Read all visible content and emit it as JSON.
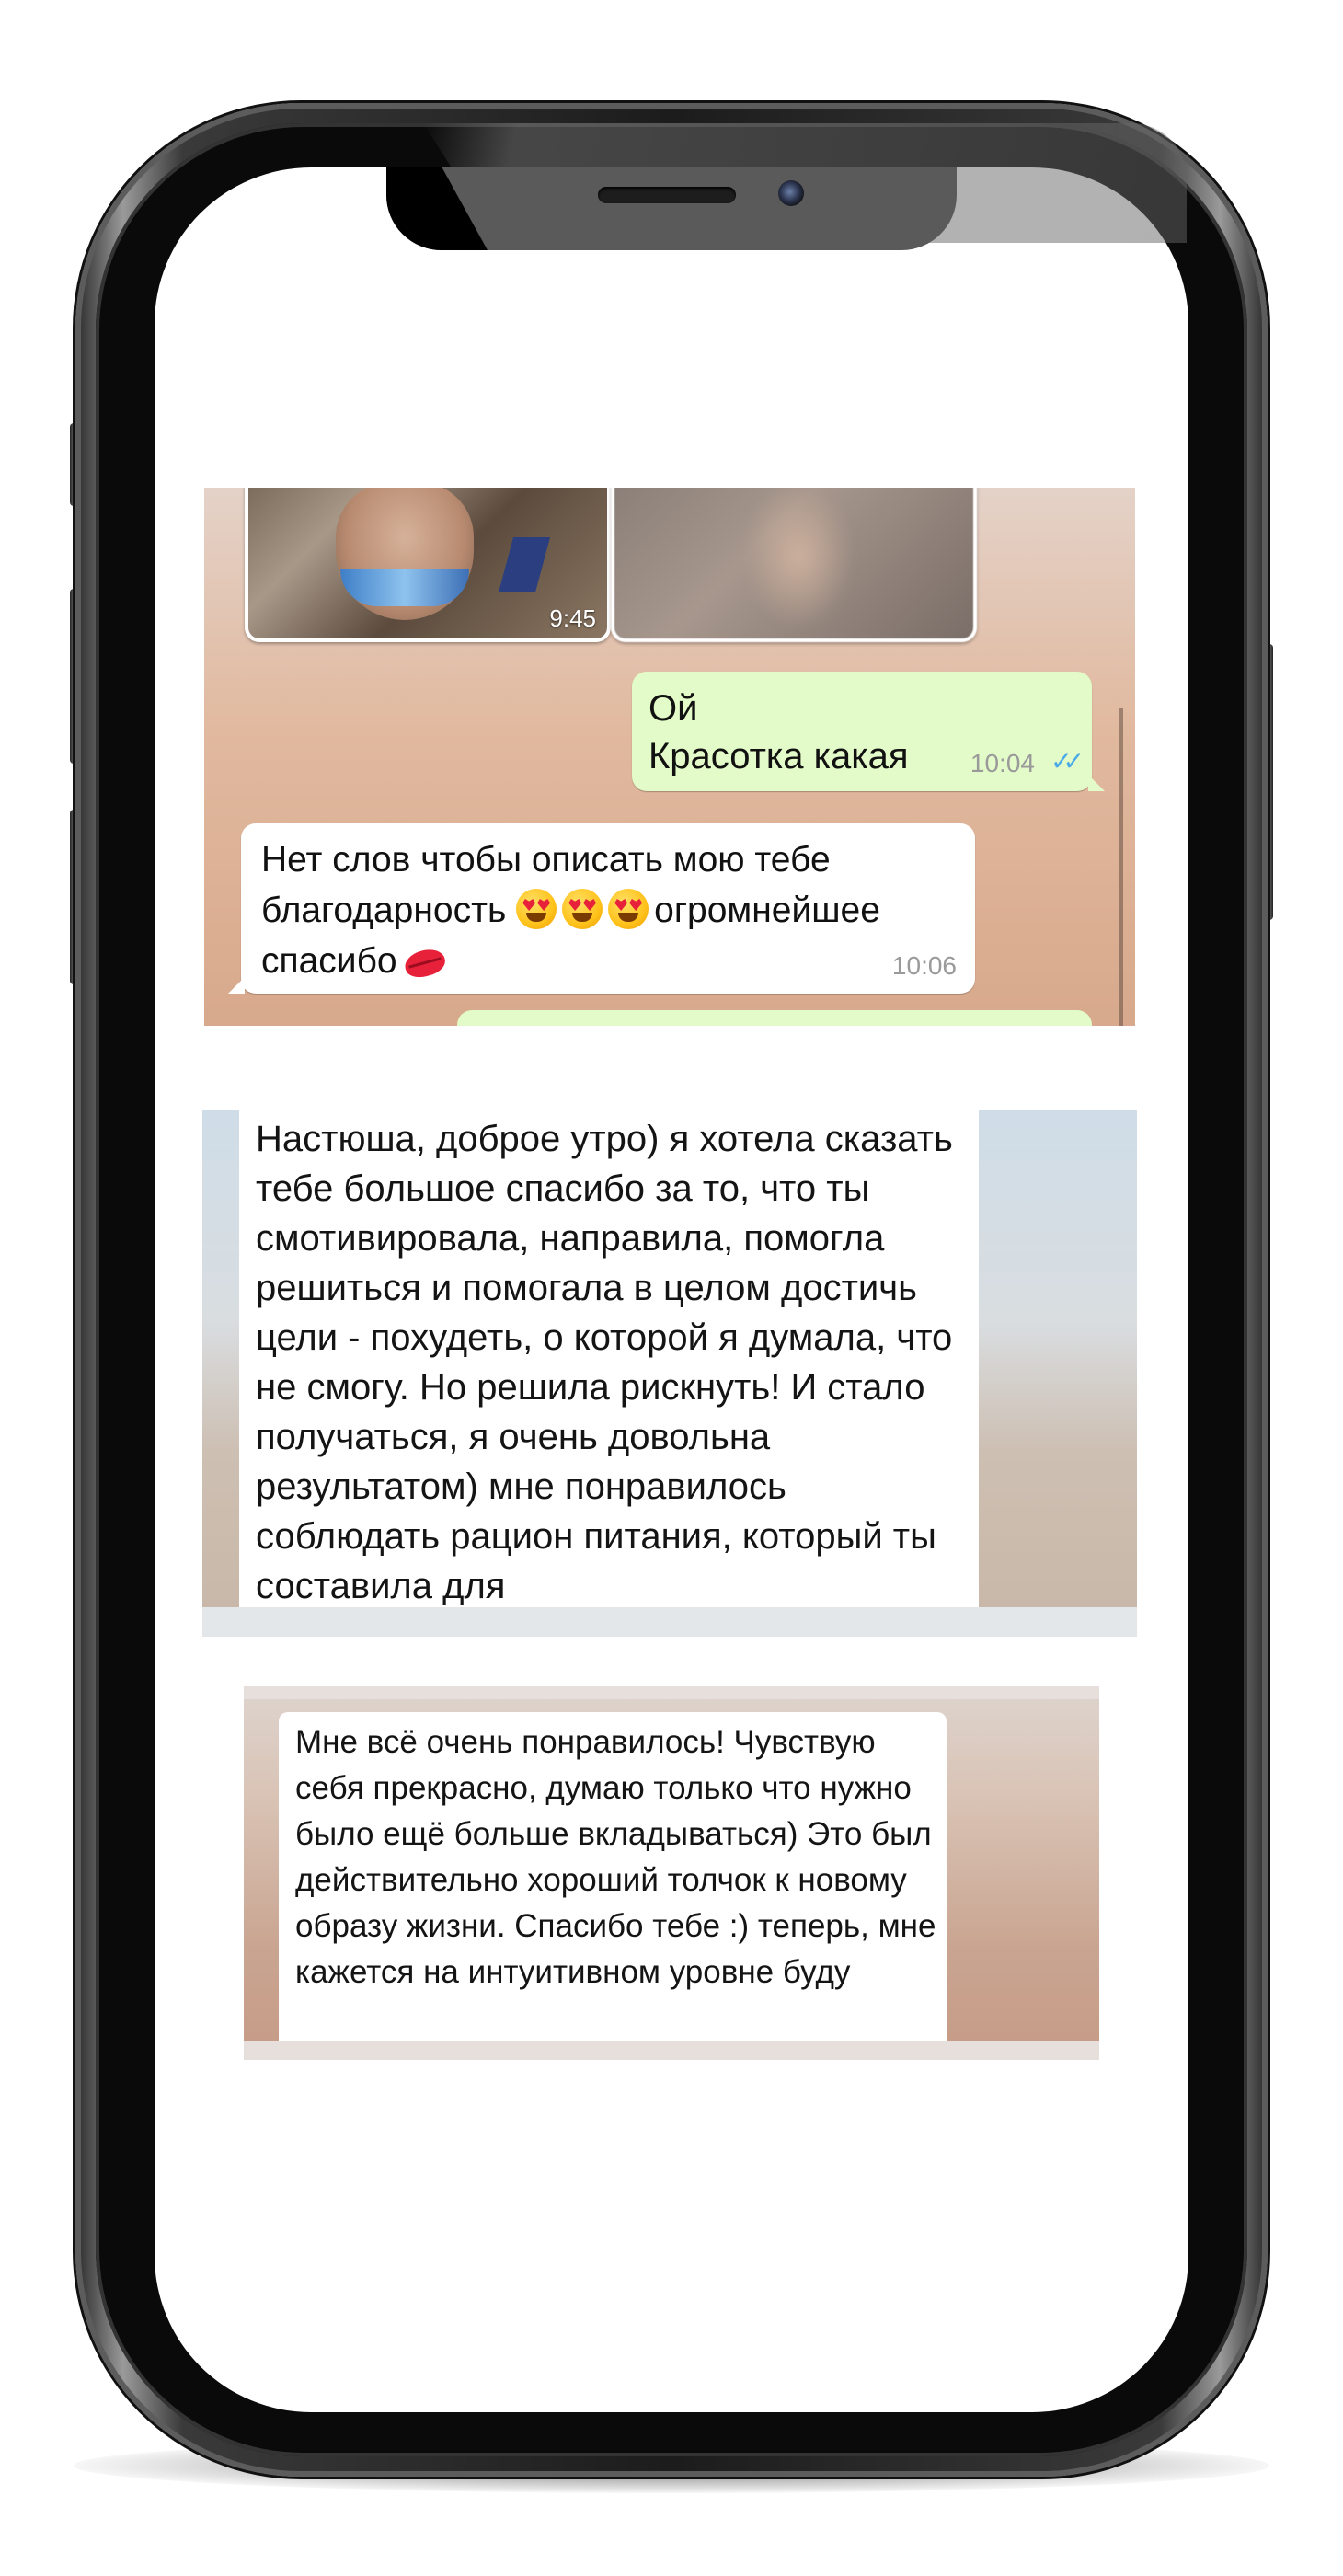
{
  "chat": {
    "photo_time": "9:45",
    "outgoing": {
      "line1": "Ой",
      "line2": "Красотка какая",
      "time": "10:04"
    },
    "incoming": {
      "part1": "Нет слов чтобы описать мою тебе благодарность ",
      "part2": "огромнейшее спасибо",
      "time": "10:06"
    }
  },
  "review2": {
    "text": "Настюша, доброе утро) я хотела сказать тебе большое спасибо за то, что ты смотивировала, направила, помогла решиться и помогала в целом достичь цели - похудеть, о которой я думала, что не смогу. Но решила рискнуть! И стало получаться, я очень довольна результатом) мне понравилось соблюдать рацион питания, который ты составила для"
  },
  "review3": {
    "text": "Мне всё очень понравилось! Чувствую себя прекрасно, думаю только что нужно было ещё больше вкладываться) Это был действительно хороший толчок к новому образу жизни. Спасибо тебе :) теперь, мне кажется на интуитивном уровне буду"
  },
  "icons": {
    "read_ticks": "double-check-icon",
    "emoji": "heart-eyes-emoji-icon",
    "kiss": "kiss-mark-icon"
  },
  "colors": {
    "outgoing_bubble": "#e2fbc8",
    "incoming_bubble": "#ffffff",
    "read_ticks": "#4aa9e8"
  }
}
